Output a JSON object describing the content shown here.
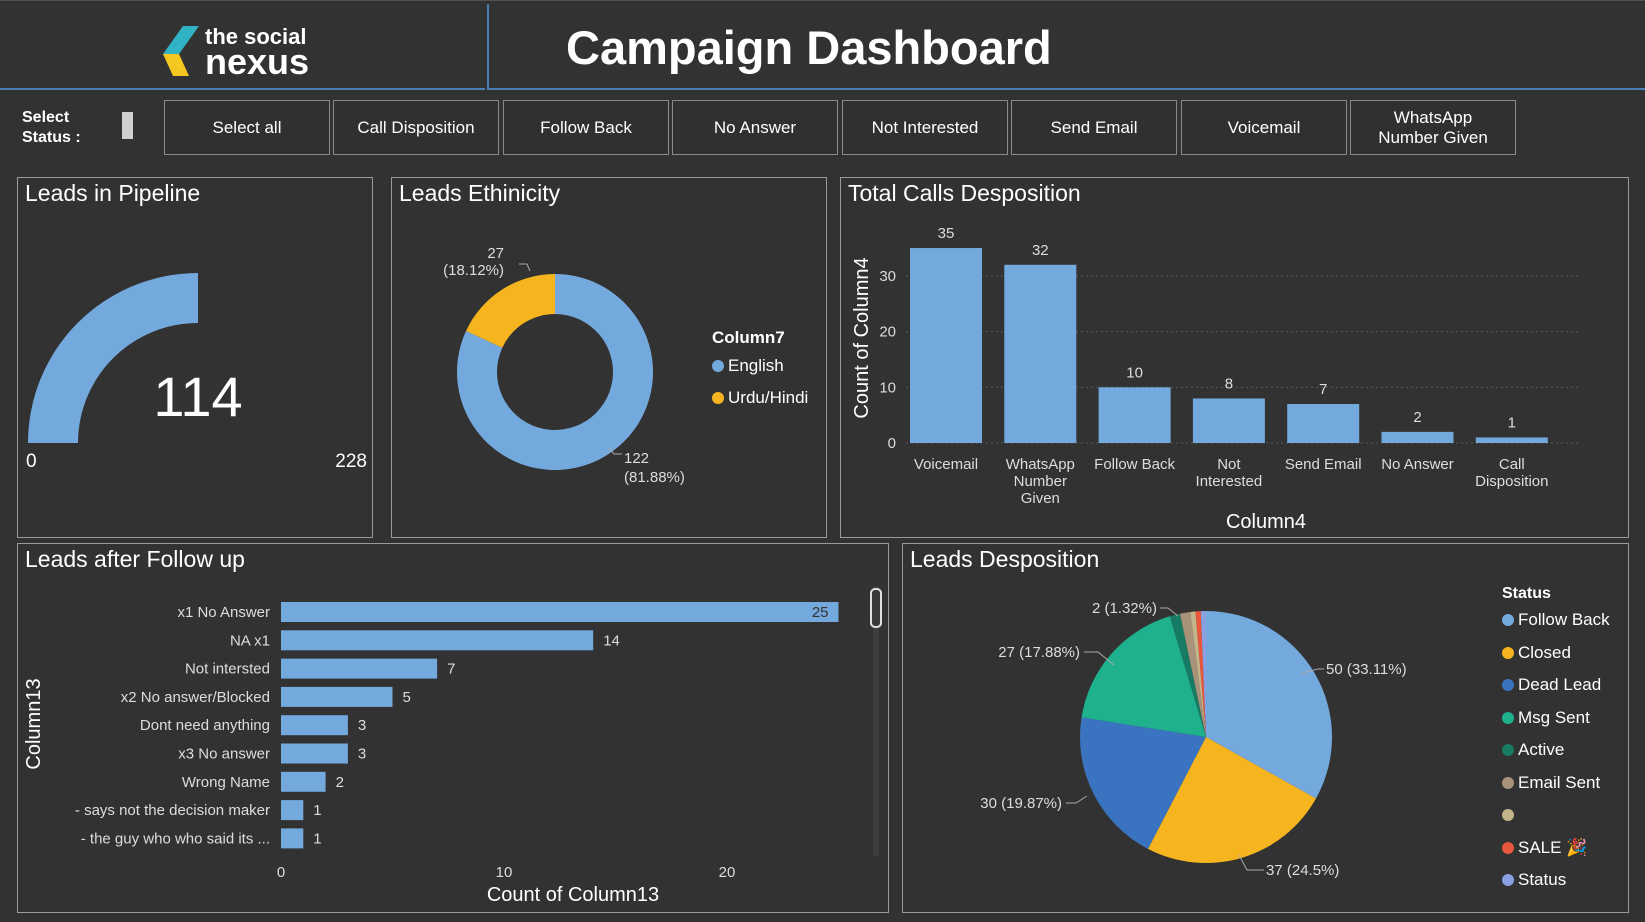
{
  "header": {
    "logo_line1": "the social",
    "logo_line2": "nexus",
    "title": "Campaign Dashboard"
  },
  "slicer": {
    "label_line1": "Select",
    "label_line2": "Status :",
    "buttons": [
      "Select all",
      "Call Disposition",
      "Follow Back",
      "No Answer",
      "Not Interested",
      "Send Email",
      "Voicemail",
      "WhatsApp Number Given"
    ]
  },
  "colors": {
    "background": "#323232",
    "bar_blue": "#74a9de",
    "accent_line": "#4a7fb5",
    "orange": "#f6b51f",
    "dark_blue": "#3a74c0",
    "teal": "#1fb08e"
  },
  "gauge": {
    "title": "Leads in Pipeline",
    "value": "114",
    "min": "0",
    "max": "228",
    "fraction": 0.5
  },
  "ethnicity": {
    "title": "Leads Ethinicity",
    "legend_title": "Column7",
    "slices": [
      {
        "name": "English",
        "value": 122,
        "label1": "122",
        "label2": "(81.88%)",
        "color": "#74a9de"
      },
      {
        "name": "Urdu/Hindi",
        "value": 27,
        "label1": "27",
        "label2": "(18.12%)",
        "color": "#f6b51f"
      }
    ]
  },
  "calls": {
    "title": "Total Calls Desposition",
    "ylabel": "Count of Column4",
    "xlabel": "Column4",
    "yticks": [
      "0",
      "10",
      "20",
      "30"
    ]
  },
  "followup": {
    "title": "Leads after Follow up",
    "ylabel": "Column13",
    "xlabel": "Count of Column13",
    "xticks": [
      "0",
      "10",
      "20"
    ]
  },
  "disposition": {
    "title": "Leads Desposition",
    "legend_title": "Status",
    "legend": [
      {
        "name": "Follow Back",
        "color": "#74a9de"
      },
      {
        "name": "Closed",
        "color": "#f6b51f"
      },
      {
        "name": "Dead Lead",
        "color": "#3a74c0"
      },
      {
        "name": "Msg Sent",
        "color": "#1fb08e"
      },
      {
        "name": "Active",
        "color": "#177a62"
      },
      {
        "name": "Email Sent",
        "color": "#a8927a"
      },
      {
        "name": "",
        "color": "#c4b48a"
      },
      {
        "name": "SALE 🎉",
        "color": "#e8573c"
      },
      {
        "name": "Status",
        "color": "#8aa0e0"
      }
    ],
    "labels": [
      "50 (33.11%)",
      "37 (24.5%)",
      "30 (19.87%)",
      "27 (17.88%)",
      "2 (1.32%)"
    ]
  },
  "chart_data": [
    {
      "type": "gauge",
      "title": "Leads in Pipeline",
      "value": 114,
      "min": 0,
      "max": 228
    },
    {
      "type": "pie",
      "title": "Leads Ethinicity",
      "categories": [
        "English",
        "Urdu/Hindi"
      ],
      "values": [
        122,
        27
      ],
      "percents": [
        81.88,
        18.12
      ]
    },
    {
      "type": "bar",
      "title": "Total Calls Desposition",
      "categories": [
        "Voicemail",
        "WhatsApp Number Given",
        "Follow Back",
        "Not Interested",
        "Send Email",
        "No Answer",
        "Call Disposition"
      ],
      "values": [
        35,
        32,
        10,
        8,
        7,
        2,
        1
      ],
      "xlabel": "Column4",
      "ylabel": "Count of Column4",
      "ylim": [
        0,
        35
      ]
    },
    {
      "type": "bar",
      "orientation": "horizontal",
      "title": "Leads after Follow up",
      "categories": [
        "x1 No Answer",
        "NA x1",
        "Not intersted",
        "x2 No answer/Blocked",
        "Dont need anything",
        "x3 No answer",
        "Wrong Name",
        "- says not the decision maker",
        "- the guy who who said its ..."
      ],
      "values": [
        25,
        14,
        7,
        5,
        3,
        3,
        2,
        1,
        1
      ],
      "xlabel": "Count of Column13",
      "ylabel": "Column13",
      "xlim": [
        0,
        25
      ]
    },
    {
      "type": "pie",
      "title": "Leads Desposition",
      "categories": [
        "Follow Back",
        "Closed",
        "Dead Lead",
        "Msg Sent",
        "Active",
        "Email Sent",
        "",
        "SALE",
        "Status"
      ],
      "values": [
        50,
        37,
        30,
        27,
        2,
        2,
        1,
        1,
        1
      ]
    }
  ]
}
